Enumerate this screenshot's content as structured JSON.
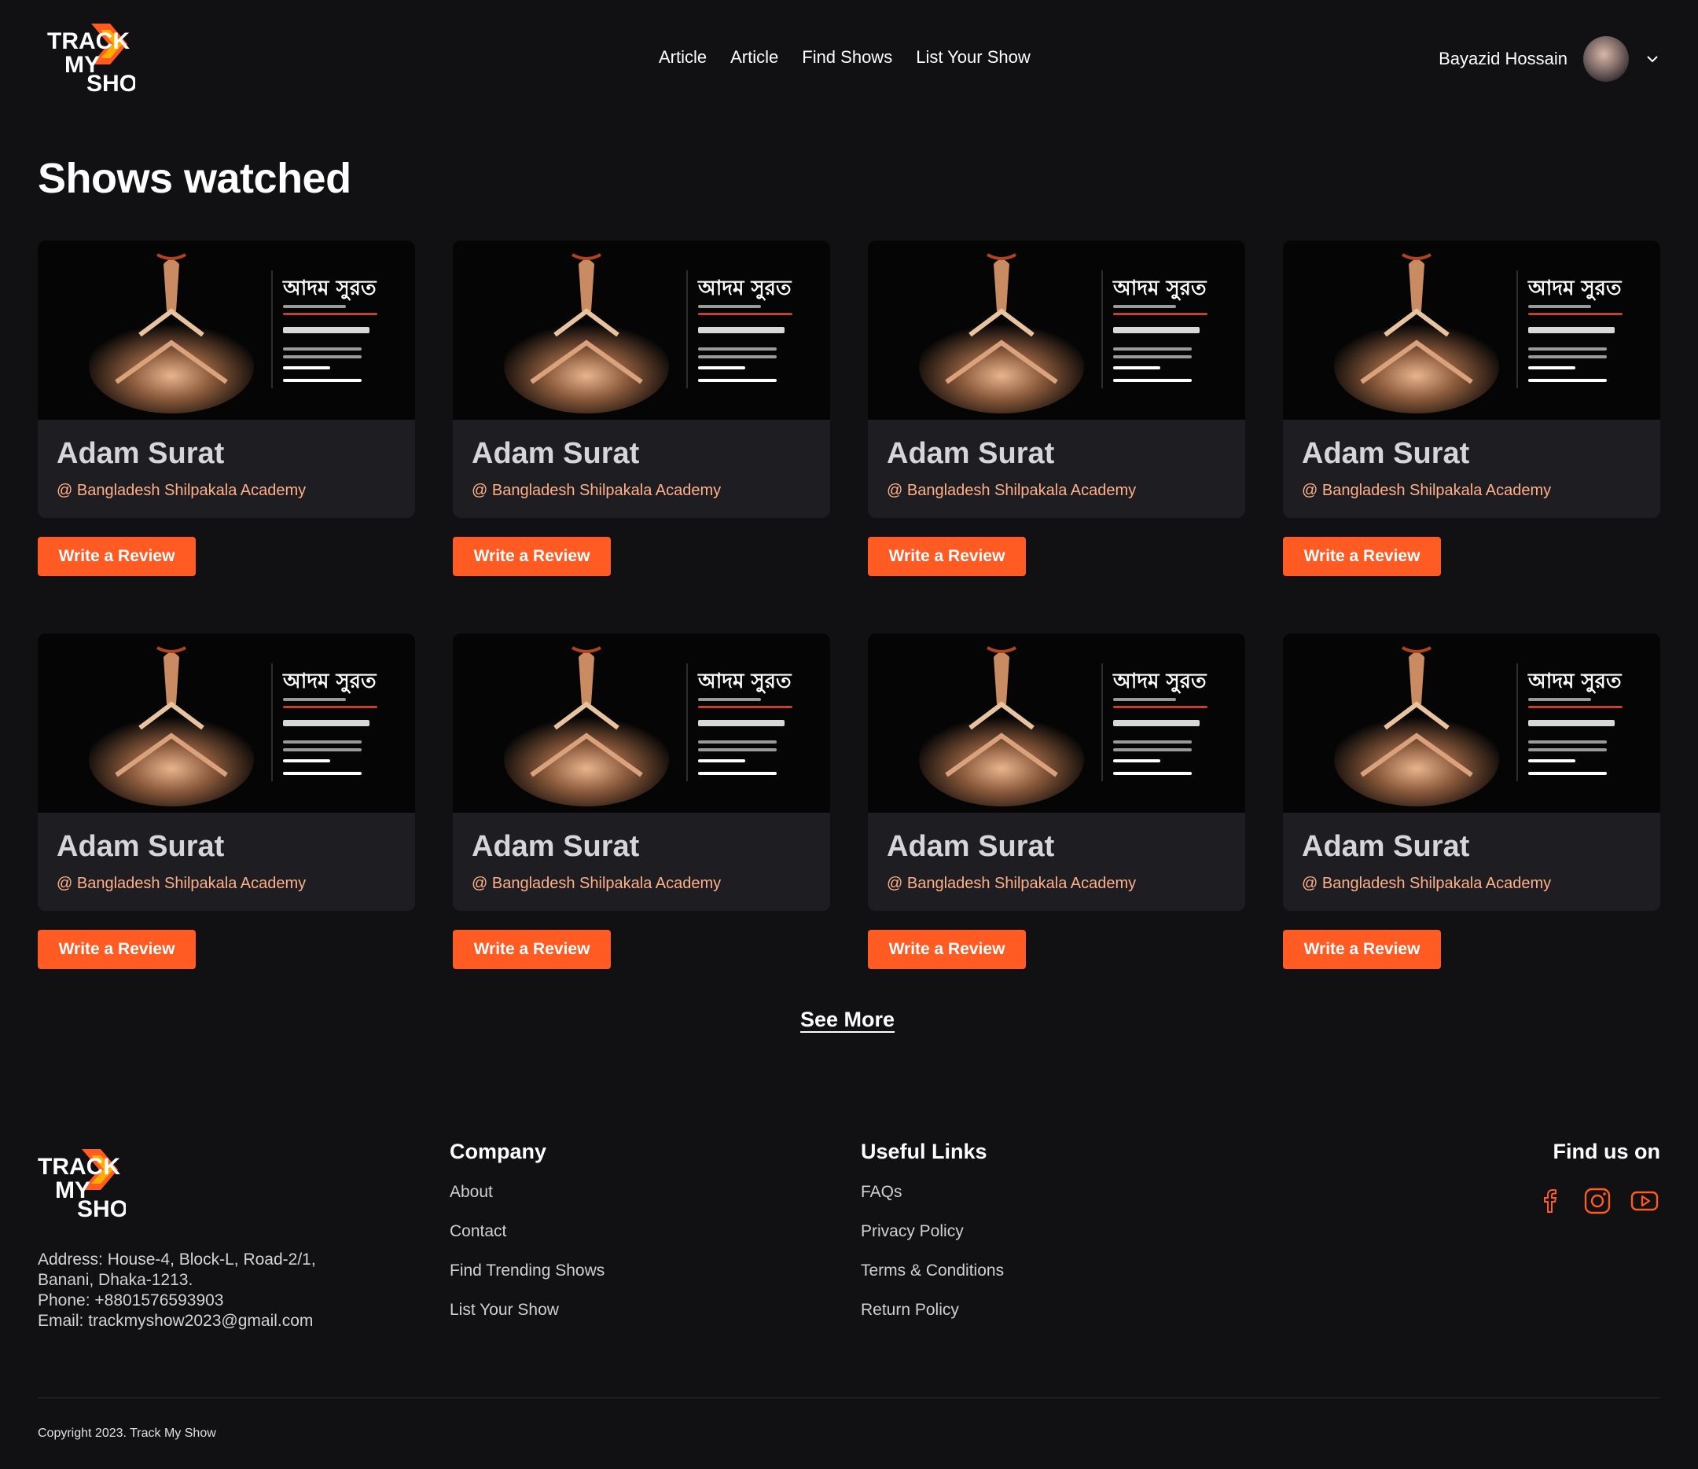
{
  "brand": {
    "logo_line1": "TRACK",
    "logo_line2": "MY",
    "logo_line3": "SHOW",
    "accent": "#ff5b22"
  },
  "nav": {
    "items": [
      "Article",
      "Article",
      "Find Shows",
      "List Your Show"
    ]
  },
  "user": {
    "name": "Bayazid Hossain",
    "avatar_icon": "user-avatar",
    "menu_icon": "chevron-down-icon"
  },
  "page": {
    "title": "Shows watched"
  },
  "shows": [
    {
      "name": "Adam Surat",
      "venue": "@ Bangladesh Shilpakala Academy",
      "poster_title": "আদম সুরত",
      "button": "Write a Review"
    },
    {
      "name": "Adam Surat",
      "venue": "@ Bangladesh Shilpakala Academy",
      "poster_title": "আদম সুরত",
      "button": "Write a Review"
    },
    {
      "name": "Adam Surat",
      "venue": "@ Bangladesh Shilpakala Academy",
      "poster_title": "আদম সুরত",
      "button": "Write a Review"
    },
    {
      "name": "Adam Surat",
      "venue": "@ Bangladesh Shilpakala Academy",
      "poster_title": "আদম সুরত",
      "button": "Write a Review"
    },
    {
      "name": "Adam Surat",
      "venue": "@ Bangladesh Shilpakala Academy",
      "poster_title": "আদম সুরত",
      "button": "Write a Review"
    },
    {
      "name": "Adam Surat",
      "venue": "@ Bangladesh Shilpakala Academy",
      "poster_title": "আদম সুরত",
      "button": "Write a Review"
    },
    {
      "name": "Adam Surat",
      "venue": "@ Bangladesh Shilpakala Academy",
      "poster_title": "আদম সুরত",
      "button": "Write a Review"
    },
    {
      "name": "Adam Surat",
      "venue": "@ Bangladesh Shilpakala Academy",
      "poster_title": "আদম সুরত",
      "button": "Write a Review"
    }
  ],
  "see_more": "See More",
  "footer": {
    "address_line1": "Address: House-4, Block-L, Road-2/1,",
    "address_line2": "Banani, Dhaka-1213.",
    "phone": "Phone:  +8801576593903",
    "email": "Email:  trackmyshow2023@gmail.com",
    "company": {
      "title": "Company",
      "links": [
        "About",
        "Contact",
        "Find Trending Shows",
        "List Your Show"
      ]
    },
    "useful": {
      "title": "Useful Links",
      "links": [
        "FAQs",
        "Privacy Policy",
        "Terms & Conditions",
        "Return Policy"
      ]
    },
    "find_us": "Find us on",
    "socials": [
      "facebook-icon",
      "instagram-icon",
      "youtube-icon"
    ],
    "copyright": "Copyright 2023. Track My Show"
  }
}
